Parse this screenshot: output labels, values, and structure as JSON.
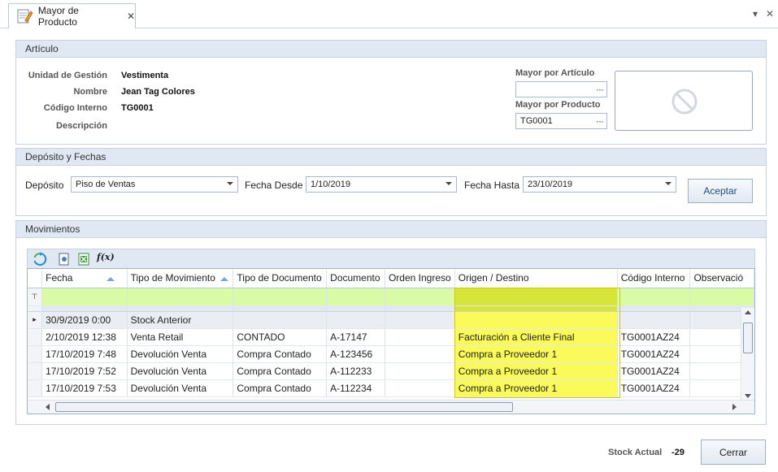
{
  "tab": {
    "title": "Mayor de Producto",
    "close": "✕"
  },
  "window": {
    "dropdown": "▾",
    "close": "✕"
  },
  "articulo": {
    "header": "Artículo",
    "labels": {
      "unidad": "Unidad de Gestión",
      "nombre": "Nombre",
      "codigo": "Código Interno",
      "descripcion": "Descripción"
    },
    "values": {
      "unidad": "Vestimenta",
      "nombre": "Jean Tag Colores",
      "codigo": "TG0001",
      "descripcion": ""
    },
    "mayor_por_articulo_label": "Mayor por Artículo",
    "mayor_por_articulo_value": "",
    "mayor_por_producto_label": "Mayor por Producto",
    "mayor_por_producto_value": "TG0001",
    "ellipsis": "···"
  },
  "deposito": {
    "header": "Depósito y Fechas",
    "deposito_label": "Depósito",
    "deposito_value": "Piso de Ventas",
    "desde_label": "Fecha Desde",
    "desde_value": "1/10/2019",
    "hasta_label": "Fecha Hasta",
    "hasta_value": "23/10/2019",
    "aceptar": "Aceptar"
  },
  "movimientos": {
    "header": "Movimientos",
    "columns": [
      "Fecha",
      "Tipo de Movimiento",
      "Tipo de Documento",
      "Documento",
      "Orden Ingreso",
      "Origen / Destino",
      "Código Interno",
      "Observació"
    ],
    "rows": [
      [
        "30/9/2019 0:00",
        "Stock Anterior",
        "",
        "",
        "",
        "",
        "",
        ""
      ],
      [
        "2/10/2019 12:38",
        "Venta Retail",
        "CONTADO",
        "A-17147",
        "",
        "Facturación a Cliente Final",
        "TG0001AZ24",
        ""
      ],
      [
        "17/10/2019 7:48",
        "Devolución Venta",
        "Compra Contado",
        "A-123456",
        "",
        "Compra a Proveedor 1",
        "TG0001AZ24",
        ""
      ],
      [
        "17/10/2019 7:52",
        "Devolución Venta",
        "Compra Contado",
        "A-112233",
        "",
        "Compra a Proveedor 1",
        "TG0001AZ24",
        ""
      ],
      [
        "17/10/2019 7:53",
        "Devolución Venta",
        "Compra Contado",
        "A-112234",
        "",
        "Compra a Proveedor 1",
        "TG0001AZ24",
        ""
      ]
    ],
    "filter_icon": "⊤",
    "row_indicator": "▸",
    "fx_label": "f(x)"
  },
  "footer": {
    "stock_label": "Stock Actual",
    "stock_value": "-29",
    "cerrar": "Cerrar"
  },
  "colors": {
    "highlight": "#fafb5b",
    "filter_row": "#d9fba5",
    "panel_header": "#dfe8f3"
  }
}
